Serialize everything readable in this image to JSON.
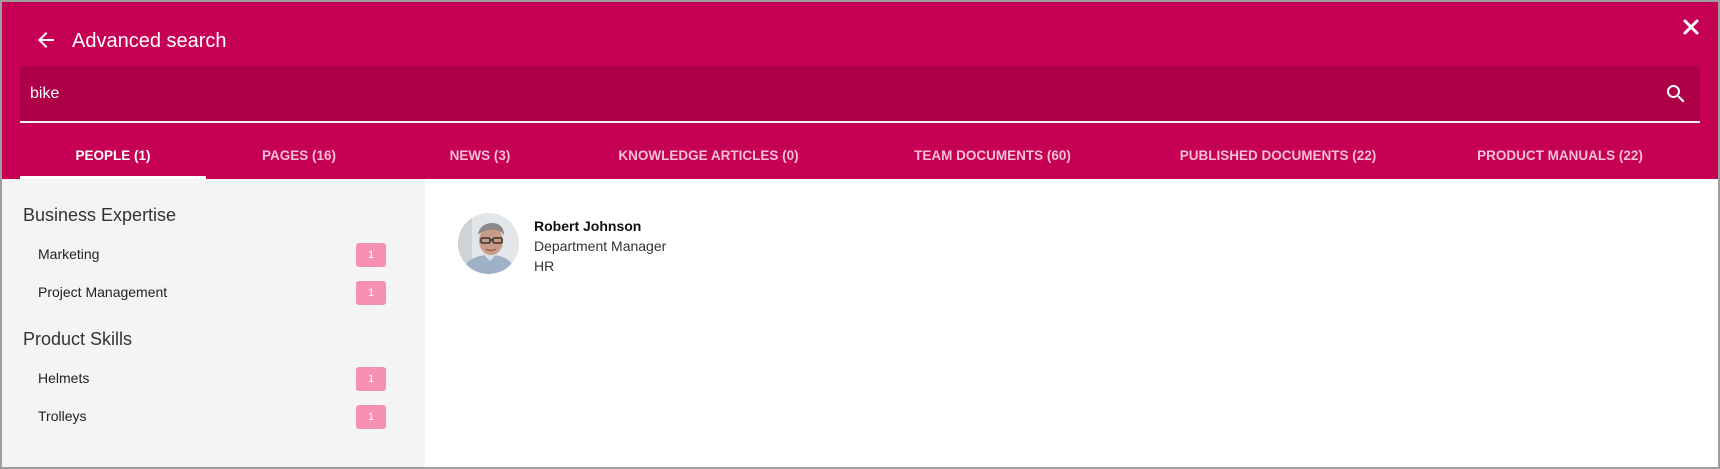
{
  "header": {
    "title": "Advanced search",
    "background_color": "#c60055",
    "back_icon": "arrow-left-icon",
    "close_icon": "close-icon"
  },
  "search": {
    "value": "bike",
    "icon": "search-icon"
  },
  "tabs": [
    {
      "label": "PEOPLE (1)",
      "active": true
    },
    {
      "label": "PAGES (16)",
      "active": false
    },
    {
      "label": "NEWS (3)",
      "active": false
    },
    {
      "label": "KNOWLEDGE ARTICLES (0)",
      "active": false
    },
    {
      "label": "TEAM DOCUMENTS (60)",
      "active": false
    },
    {
      "label": "PUBLISHED DOCUMENTS (22)",
      "active": false
    },
    {
      "label": "PRODUCT MANUALS (22)",
      "active": false
    }
  ],
  "sidebar": {
    "groups": [
      {
        "title": "Business Expertise",
        "items": [
          {
            "label": "Marketing",
            "count": "1"
          },
          {
            "label": "Project Management",
            "count": "1"
          }
        ]
      },
      {
        "title": "Product Skills",
        "items": [
          {
            "label": "Helmets",
            "count": "1"
          },
          {
            "label": "Trolleys",
            "count": "1"
          }
        ]
      }
    ],
    "count_badge_color": "#f68fb4"
  },
  "results": [
    {
      "name": "Robert Johnson",
      "title": "Department Manager",
      "department": "HR"
    }
  ]
}
